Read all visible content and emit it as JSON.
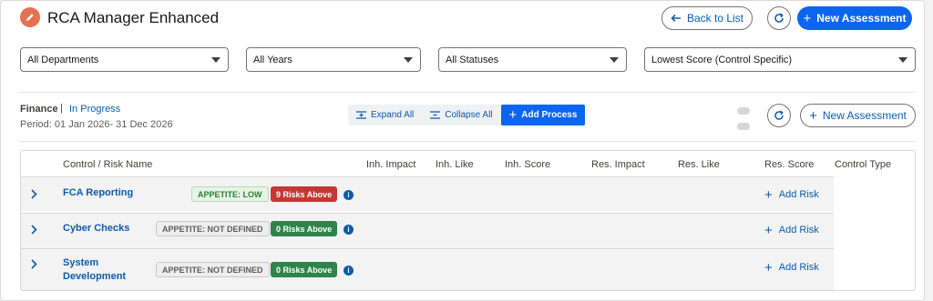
{
  "header": {
    "title": "RCA Manager Enhanced",
    "back_label": "Back to List",
    "new_assessment_label": "New Assessment"
  },
  "filters": {
    "department": "All Departments",
    "year": "All Years",
    "status": "All Statuses",
    "sort": "Lowest Score (Control Specific)"
  },
  "context": {
    "department": "Finance",
    "separator": "|",
    "status": "In Progress",
    "period": "Period: 01 Jan 2026- 31 Dec 2026"
  },
  "actions": {
    "expand_all": "Expand All",
    "collapse_all": "Collapse All",
    "add_process": "Add Process",
    "new_assessment": "New Assessment"
  },
  "table": {
    "columns": [
      "Control / Risk Name",
      "Inh. Impact",
      "Inh. Like",
      "Inh. Score",
      "Res. Impact",
      "Res. Like",
      "Res. Score",
      "Control Type"
    ],
    "rows": [
      {
        "name": "FCA Reporting",
        "appetite": "APPETITE: LOW",
        "risks": "9 Risks Above",
        "add_risk": "Add Risk"
      },
      {
        "name": "Cyber Checks",
        "appetite": "APPETITE: NOT DEFINED",
        "risks": "0 Risks Above",
        "add_risk": "Add Risk"
      },
      {
        "name": "System Development",
        "name_line1": "System",
        "name_line2": "Development",
        "appetite": "APPETITE: NOT DEFINED",
        "risks": "0 Risks Above",
        "add_risk": "Add Risk"
      }
    ]
  },
  "icons": {
    "app": "edit-pencil-icon",
    "back": "arrow-left-icon",
    "refresh": "refresh-icon",
    "add": "plus-icon",
    "expand": "expand-icon",
    "collapse": "collapse-icon",
    "info": "info-icon",
    "row_toggle": "chevron-right-icon"
  },
  "colors": {
    "brand": "#0b65f0",
    "link": "#0b5cab",
    "app_icon": "#e3724f",
    "risk_red": "#c23934",
    "risk_green": "#2e844a"
  }
}
